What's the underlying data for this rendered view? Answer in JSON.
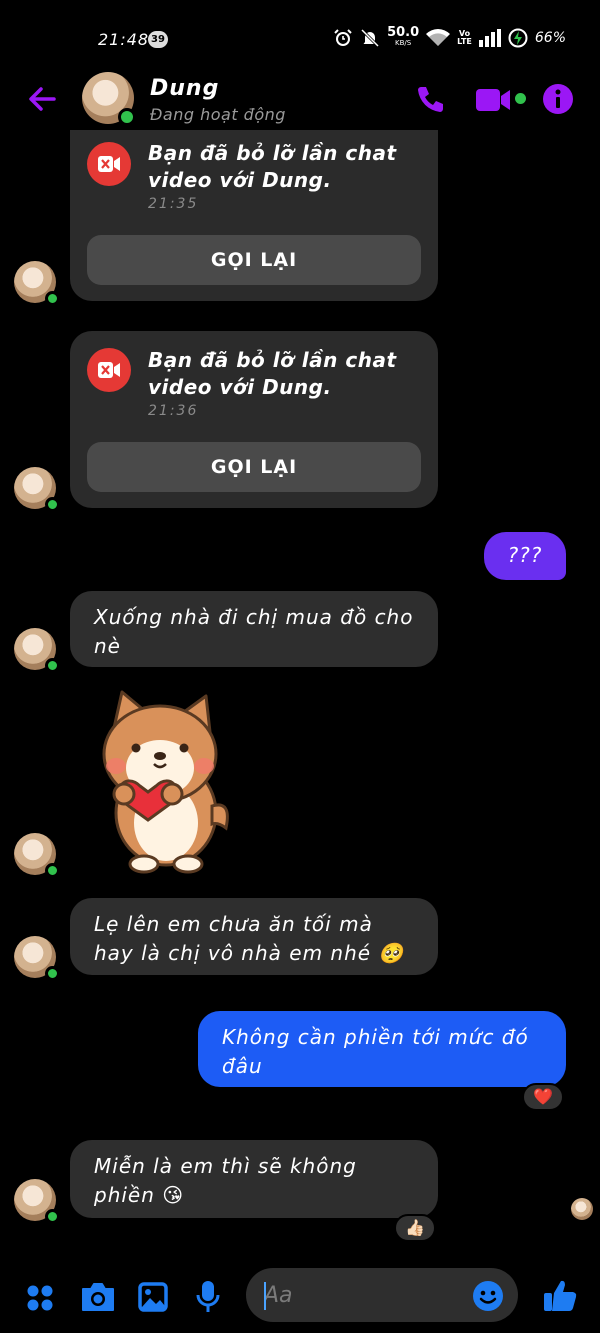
{
  "status_bar": {
    "time": "21:48",
    "notification_count": "39",
    "net_speed": "50.0",
    "net_speed_unit": "KB/S",
    "volte_top": "Vo",
    "volte_bottom": "LTE",
    "battery": "66%"
  },
  "header": {
    "contact_name": "Dung",
    "contact_status": "Đang hoạt động"
  },
  "messages": {
    "missed_1": {
      "title": "Bạn đã bỏ lỡ lần chat video với Dung.",
      "time": "21:35",
      "action": "GỌI LẠI"
    },
    "missed_2": {
      "title": "Bạn đã bỏ lỡ lần chat video với Dung.",
      "time": "21:36",
      "action": "GỌI LẠI"
    },
    "out_1": "???",
    "in_1": "Xuống nhà đi chị mua đồ cho nè",
    "in_2": "Lẹ lên em chưa ăn tối mà hay là chị vô nhà em nhé 🥺",
    "out_2": "Không cần phiền tới mức đó đâu",
    "out_2_reaction": "❤️",
    "in_3": "Miễn là em thì sẽ không phiền 😘",
    "in_3_reaction": "👍🏻"
  },
  "composer": {
    "placeholder": "Aa"
  },
  "colors": {
    "accent_purple": "#9b17f5",
    "outgoing_purple": "#6a2ff0",
    "outgoing_blue": "#1d5cf5",
    "composer_blue": "#1e7cf2",
    "online_green": "#31c24d",
    "missed_red": "#e53935"
  }
}
